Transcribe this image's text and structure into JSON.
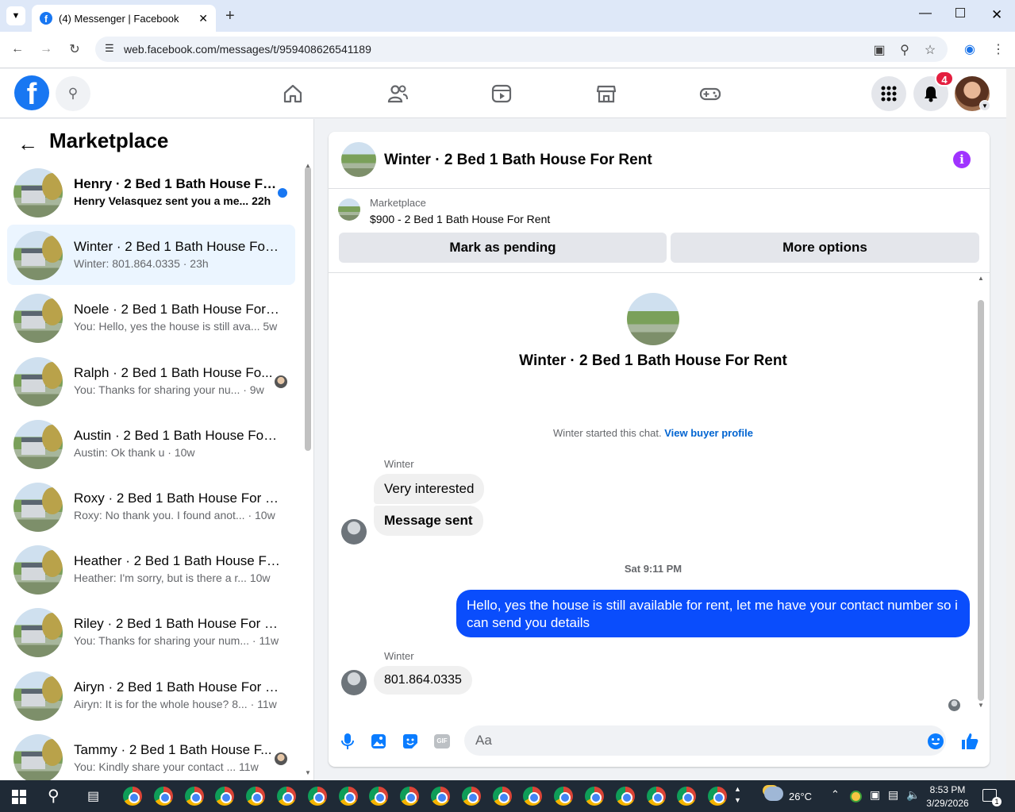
{
  "browser": {
    "tab_title": "(4) Messenger | Facebook",
    "url": "web.facebook.com/messages/t/959408626541189"
  },
  "header": {
    "notification_count": "4"
  },
  "sidebar": {
    "title": "Marketplace",
    "conversations": [
      {
        "name": "Henry · 2 Bed 1 Bath House Fo...",
        "preview": "Henry Velasquez sent you a me...",
        "time": "22h",
        "unread": true
      },
      {
        "name": "Winter · 2 Bed 1 Bath House For ...",
        "preview": "Winter: 801.864.0335 · 23h",
        "time": "",
        "active": true
      },
      {
        "name": "Noele · 2 Bed 1 Bath House For ...",
        "preview": "You: Hello, yes the house is still ava...",
        "time": "5w"
      },
      {
        "name": "Ralph · 2 Bed 1 Bath House Fo...",
        "preview": "You: Thanks for sharing your nu...",
        "time": "· 9w"
      },
      {
        "name": "Austin · 2 Bed 1 Bath House For ...",
        "preview": "Austin: Ok thank u · 10w",
        "time": ""
      },
      {
        "name": "Roxy · 2 Bed 1 Bath House For R...",
        "preview": "Roxy: No thank you. I found anot...",
        "time": "· 10w"
      },
      {
        "name": "Heather · 2 Bed 1 Bath House Fo...",
        "preview": "Heather: I'm sorry, but is there a r...",
        "time": "10w"
      },
      {
        "name": "Riley · 2 Bed 1 Bath House For R...",
        "preview": "You: Thanks for sharing your num...",
        "time": "· 11w"
      },
      {
        "name": "Airyn · 2 Bed 1 Bath House For R...",
        "preview": "Airyn: It is for the whole house? 8...",
        "time": "· 11w"
      },
      {
        "name": "Tammy · 2 Bed 1 Bath House F...",
        "preview": "You: Kindly share your contact ...",
        "time": "11w"
      }
    ]
  },
  "chat": {
    "title": "Winter · 2 Bed 1 Bath House For Rent",
    "marketplace_label": "Marketplace",
    "listing": "$900 - 2 Bed 1 Bath House For Rent",
    "mark_pending": "Mark as pending",
    "more_options": "More options",
    "conv_title": "Winter · 2 Bed 1 Bath House For Rent",
    "started": "Winter started this chat.",
    "view_profile": "View buyer profile",
    "messages": [
      {
        "sender": "Winter",
        "text": "Very interested"
      },
      {
        "text": "Message sent"
      },
      {
        "timestamp": "Sat 9:11 PM"
      },
      {
        "text": "Hello, yes the house is still available for rent, let me have your contact number so i can send you  details",
        "outgoing": true
      },
      {
        "sender": "Winter",
        "text": "801.864.0335"
      }
    ],
    "input_placeholder": "Aa"
  },
  "taskbar": {
    "weather": "26°C",
    "time": "8:53 PM",
    "date": "3/29/2026",
    "notif": "1"
  }
}
